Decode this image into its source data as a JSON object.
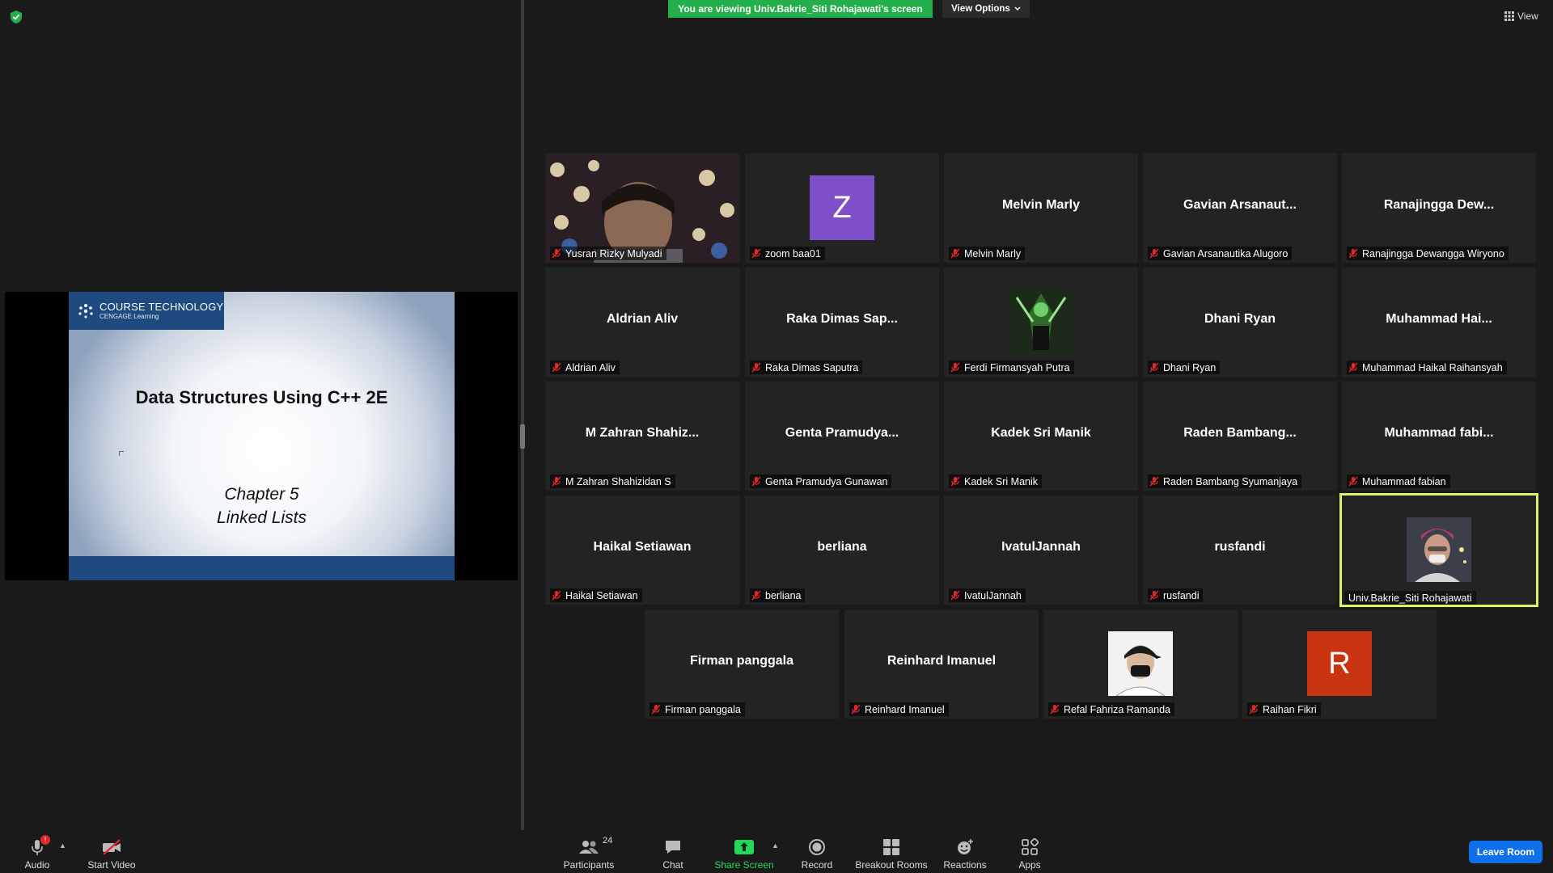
{
  "banner": {
    "text": "You are viewing Univ.Bakrie_Siti Rohajawati's screen",
    "view_options": "View Options"
  },
  "view_button": {
    "label": "View"
  },
  "slide": {
    "brand_line1": "COURSE TECHNOLOGY",
    "brand_line2": "CENGAGE Learning",
    "title": "Data Structures Using C++ 2E",
    "chapter": "Chapter 5",
    "subtitle": "Linked Lists"
  },
  "participants": [
    {
      "big": "",
      "label": "Yusran Rizky Mulyadi",
      "avatar": "video-feed"
    },
    {
      "big": "",
      "label": "zoom baa01",
      "avatar": "letter",
      "letter": "Z",
      "avatar_color": "#7e4fc9"
    },
    {
      "big": "Melvin Marly",
      "label": "Melvin Marly"
    },
    {
      "big": "Gavian  Arsanaut...",
      "label": "Gavian Arsanautika Alugoro"
    },
    {
      "big": "Ranajingga  Dew...",
      "label": "Ranajingga Dewangga Wiryono"
    },
    {
      "big": "Aldrian Aliv",
      "label": "Aldrian Aliv"
    },
    {
      "big": "Raka  Dimas  Sap...",
      "label": "Raka Dimas Saputra"
    },
    {
      "big": "",
      "label": "Ferdi Firmansyah Putra",
      "avatar": "photo-green"
    },
    {
      "big": "Dhani Ryan",
      "label": "Dhani Ryan"
    },
    {
      "big": "Muhammad  Hai...",
      "label": "Muhammad Haikal Raihansyah"
    },
    {
      "big": "M  Zahran  Shahiz...",
      "label": "M Zahran Shahizidan S"
    },
    {
      "big": "Genta  Pramudya...",
      "label": "Genta Pramudya Gunawan"
    },
    {
      "big": "Kadek Sri Manik",
      "label": "Kadek Sri Manik"
    },
    {
      "big": "Raden  Bambang...",
      "label": "Raden Bambang Syumanjaya"
    },
    {
      "big": "Muhammad  fabi...",
      "label": "Muhammad fabian"
    },
    {
      "big": "Haikal Setiawan",
      "label": "Haikal Setiawan"
    },
    {
      "big": "berliana",
      "label": "berliana"
    },
    {
      "big": "IvatulJannah",
      "label": "IvatulJannah"
    },
    {
      "big": "rusfandi",
      "label": "rusfandi"
    },
    {
      "big": "",
      "label": "Univ.Bakrie_Siti Rohajawati",
      "avatar": "photo-person",
      "active": true,
      "unmuted": true
    },
    {
      "big": "Firman panggala",
      "label": "Firman panggala"
    },
    {
      "big": "Reinhard Imanuel",
      "label": "Reinhard Imanuel"
    },
    {
      "big": "",
      "label": "Refal Fahriza Ramanda",
      "avatar": "photo-cap"
    },
    {
      "big": "",
      "label": "Raihan Fikri",
      "avatar": "letter",
      "letter": "R",
      "avatar_color": "#c8340f"
    }
  ],
  "toolbar": {
    "audio": "Audio",
    "audio_badge": "!",
    "start_video": "Start Video",
    "participants": "Participants",
    "participants_count": "24",
    "chat": "Chat",
    "share_screen": "Share Screen",
    "record": "Record",
    "breakout_rooms": "Breakout Rooms",
    "reactions": "Reactions",
    "apps": "Apps",
    "leave_room": "Leave Room"
  },
  "colors": {
    "banner_green": "#23b04a",
    "active_border": "#e3ef6e",
    "leave_blue": "#0e71eb",
    "share_green": "#23d959"
  }
}
